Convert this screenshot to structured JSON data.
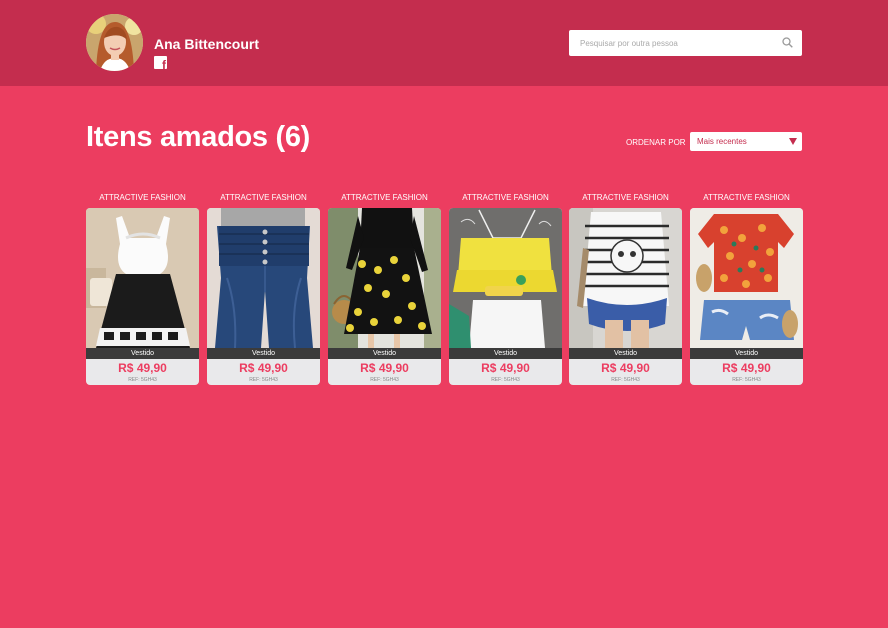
{
  "user": {
    "name": "Ana Bittencourt",
    "social_icon": "facebook-icon"
  },
  "search": {
    "placeholder": "Pesquisar por outra pessoa",
    "icon": "search-icon"
  },
  "page": {
    "title": "Itens amados (6)",
    "sort_label": "ORDENAR POR",
    "sort_value": "Mais recentes"
  },
  "colors": {
    "header": "#c42d4e",
    "background": "#ec3d60",
    "price": "#ec3d60"
  },
  "products": [
    {
      "brand": "ATTRACTIVE FASHION",
      "tag": "Vestido",
      "price": "R$ 49,90",
      "ref": "REF: 5GH43"
    },
    {
      "brand": "ATTRACTIVE FASHION",
      "tag": "Vestido",
      "price": "R$ 49,90",
      "ref": "REF: 5GH43"
    },
    {
      "brand": "ATTRACTIVE FASHION",
      "tag": "Vestido",
      "price": "R$ 49,90",
      "ref": "REF: 5GH43"
    },
    {
      "brand": "ATTRACTIVE FASHION",
      "tag": "Vestido",
      "price": "R$ 49,90",
      "ref": "REF: 5GH43"
    },
    {
      "brand": "ATTRACTIVE FASHION",
      "tag": "Vestido",
      "price": "R$ 49,90",
      "ref": "REF: 5GH43"
    },
    {
      "brand": "ATTRACTIVE FASHION",
      "tag": "Vestido",
      "price": "R$ 49,90",
      "ref": "REF: 5GH43"
    }
  ]
}
